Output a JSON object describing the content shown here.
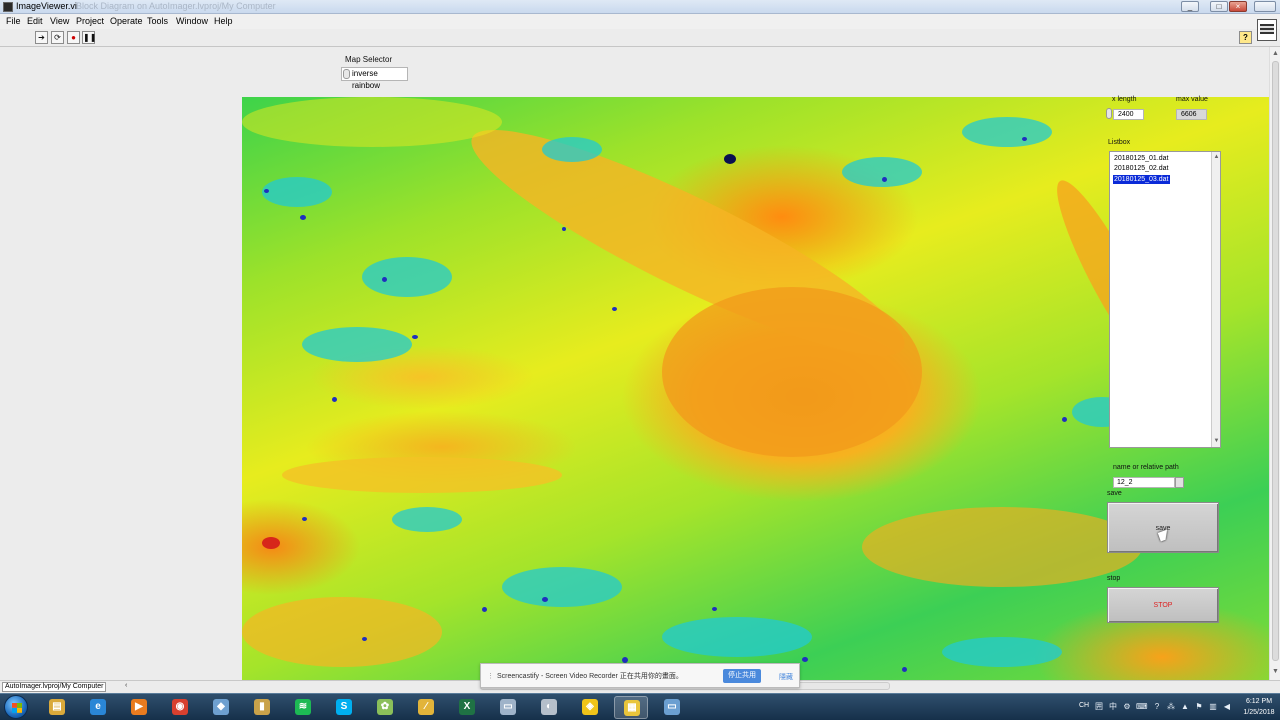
{
  "window": {
    "title": "ImageViewer.vi",
    "title_ghost": "Block Diagram on AutoImager.lvproj/My Computer",
    "controls": [
      "_",
      "□",
      "×"
    ]
  },
  "menu": [
    "File",
    "Edit",
    "View",
    "Project",
    "Operate",
    "Tools",
    "Window",
    "Help"
  ],
  "toolbar": {
    "run_glyph": "➔",
    "run_cont_glyph": "⟳",
    "abort_glyph": "●",
    "pause_glyph": "❚❚",
    "help_glyph": "?"
  },
  "map_selector": {
    "label": "Map Selector",
    "value": "inverse rainbow"
  },
  "x_length": {
    "label": "x length",
    "value": "2400"
  },
  "max_value": {
    "label": "max value",
    "value": "6606"
  },
  "listbox": {
    "label": "Listbox",
    "items": [
      "20180125_01.dat",
      "20180125_02.dat",
      "20180125_03.dat"
    ],
    "selected_index": 2
  },
  "path": {
    "label": "name or relative path",
    "value": "12_2"
  },
  "save": {
    "label": "save",
    "button_text": "save"
  },
  "stop": {
    "label": "stop",
    "button_text": "STOP"
  },
  "status": {
    "project_path": "AutoImager.lvproj/My Computer",
    "arrow": "‹"
  },
  "notification": {
    "message": "Screencastify - Screen Video Recorder 正在共用你的畫面。",
    "stop_sharing": "停止共用",
    "hide": "隱藏"
  },
  "taskbar": {
    "apps": [
      {
        "name": "explorer",
        "glyph": "▤",
        "color": "#d9a93b"
      },
      {
        "name": "ie",
        "glyph": "e",
        "color": "#2a86d6"
      },
      {
        "name": "media-player",
        "glyph": "▶",
        "color": "#e87b1f"
      },
      {
        "name": "chrome",
        "glyph": "◉",
        "color": "#d8402f"
      },
      {
        "name": "app-5",
        "glyph": "◆",
        "color": "#6ea0d0"
      },
      {
        "name": "app-6",
        "glyph": "▮",
        "color": "#c9a24a"
      },
      {
        "name": "spotify",
        "glyph": "≋",
        "color": "#1db954"
      },
      {
        "name": "skype",
        "glyph": "S",
        "color": "#00aff0"
      },
      {
        "name": "app-9",
        "glyph": "✿",
        "color": "#8bbf5a"
      },
      {
        "name": "app-10",
        "glyph": "∕",
        "color": "#e2b43a"
      },
      {
        "name": "excel",
        "glyph": "X",
        "color": "#1f7244"
      },
      {
        "name": "app-12",
        "glyph": "▭",
        "color": "#9fb3c9"
      },
      {
        "name": "app-13",
        "glyph": "◐",
        "color": "#b5bfcb"
      },
      {
        "name": "app-14",
        "glyph": "◈",
        "color": "#f0c419"
      },
      {
        "name": "labview",
        "glyph": "▦",
        "color": "#e9c53b"
      },
      {
        "name": "app-16",
        "glyph": "▭",
        "color": "#6b9fd1"
      }
    ],
    "active_index": 14,
    "lang": "CH",
    "time": "6:12 PM",
    "date": "1/25/2018"
  }
}
